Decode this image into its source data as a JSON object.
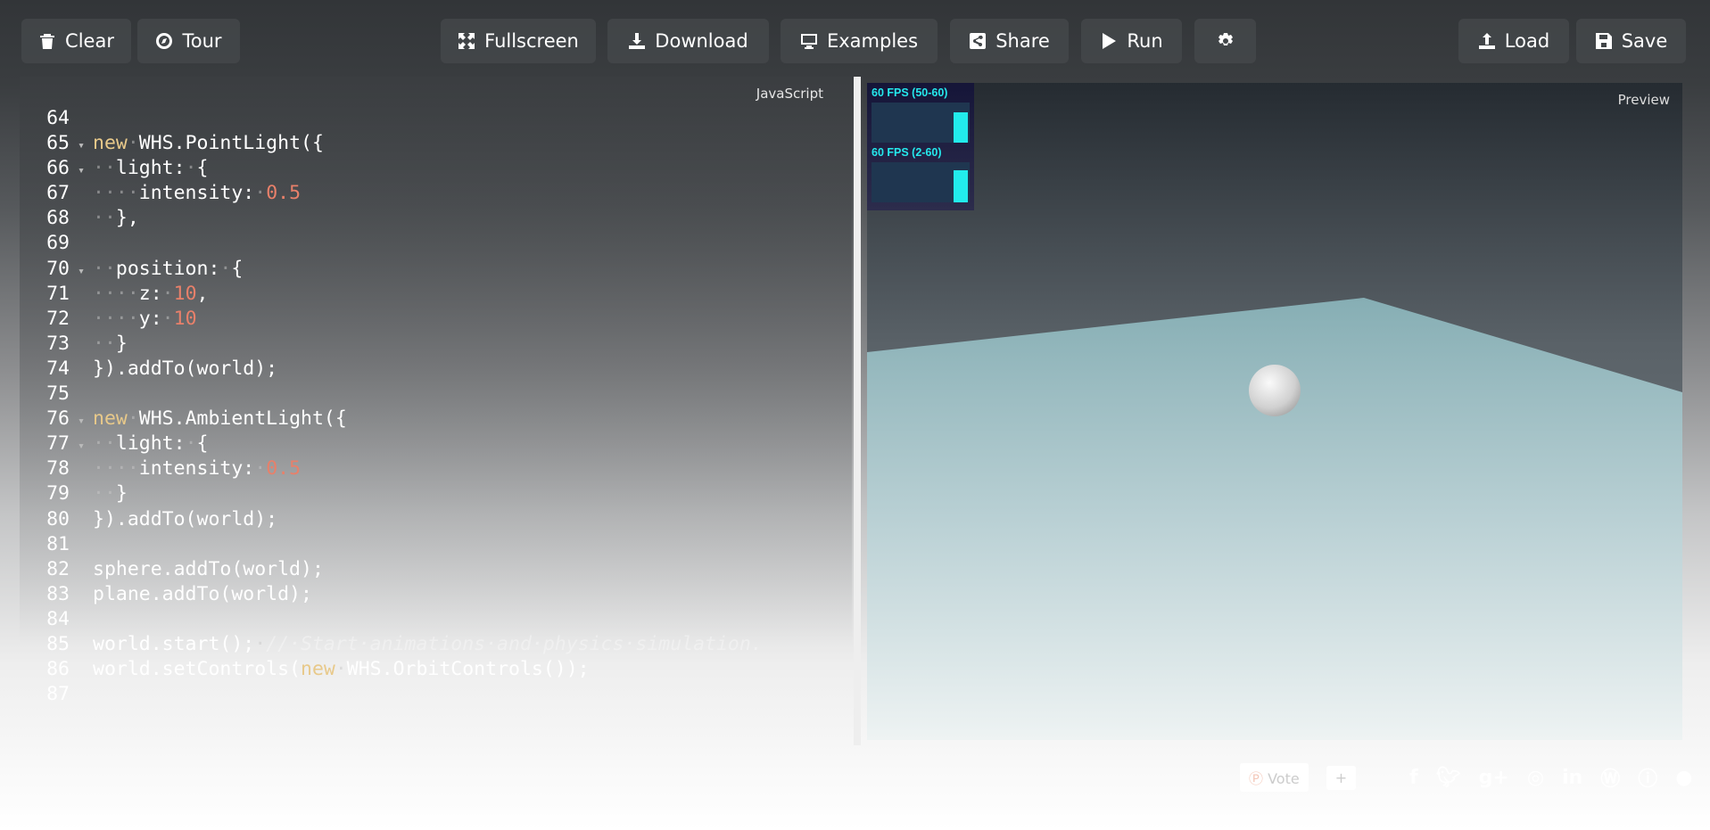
{
  "toolbar": {
    "clear": "Clear",
    "tour": "Tour",
    "fullscreen": "Fullscreen",
    "download": "Download",
    "examples": "Examples",
    "share": "Share",
    "run": "Run",
    "load": "Load",
    "save": "Save"
  },
  "editor": {
    "language": "JavaScript",
    "lines": [
      {
        "n": "64",
        "fold": false,
        "seg": []
      },
      {
        "n": "65",
        "fold": true,
        "seg": [
          [
            "new",
            "kw"
          ],
          [
            "·",
            "ws"
          ],
          [
            "WHS.PointLight({",
            "pl"
          ]
        ]
      },
      {
        "n": "66",
        "fold": true,
        "seg": [
          [
            "··",
            "ws"
          ],
          [
            "light:",
            "pl"
          ],
          [
            "·",
            "ws"
          ],
          [
            "{",
            "pl"
          ]
        ]
      },
      {
        "n": "67",
        "fold": false,
        "seg": [
          [
            "····",
            "ws"
          ],
          [
            "intensity:",
            "pl"
          ],
          [
            "·",
            "ws"
          ],
          [
            "0.5",
            "num"
          ]
        ]
      },
      {
        "n": "68",
        "fold": false,
        "seg": [
          [
            "··",
            "ws"
          ],
          [
            "},",
            "pl"
          ]
        ]
      },
      {
        "n": "69",
        "fold": false,
        "seg": []
      },
      {
        "n": "70",
        "fold": true,
        "seg": [
          [
            "··",
            "ws"
          ],
          [
            "position:",
            "pl"
          ],
          [
            "·",
            "ws"
          ],
          [
            "{",
            "pl"
          ]
        ]
      },
      {
        "n": "71",
        "fold": false,
        "seg": [
          [
            "····",
            "ws"
          ],
          [
            "z:",
            "pl"
          ],
          [
            "·",
            "ws"
          ],
          [
            "10",
            "num"
          ],
          [
            ",",
            "pl"
          ]
        ]
      },
      {
        "n": "72",
        "fold": false,
        "seg": [
          [
            "····",
            "ws"
          ],
          [
            "y:",
            "pl"
          ],
          [
            "·",
            "ws"
          ],
          [
            "10",
            "num"
          ]
        ]
      },
      {
        "n": "73",
        "fold": false,
        "seg": [
          [
            "··",
            "ws"
          ],
          [
            "}",
            "pl"
          ]
        ]
      },
      {
        "n": "74",
        "fold": false,
        "seg": [
          [
            "}).addTo(world);",
            "pl"
          ]
        ]
      },
      {
        "n": "75",
        "fold": false,
        "seg": []
      },
      {
        "n": "76",
        "fold": true,
        "seg": [
          [
            "new",
            "kw"
          ],
          [
            "·",
            "ws"
          ],
          [
            "WHS.AmbientLight({",
            "pl"
          ]
        ]
      },
      {
        "n": "77",
        "fold": true,
        "seg": [
          [
            "··",
            "ws"
          ],
          [
            "light:",
            "pl"
          ],
          [
            "·",
            "ws"
          ],
          [
            "{",
            "pl"
          ]
        ]
      },
      {
        "n": "78",
        "fold": false,
        "seg": [
          [
            "····",
            "ws"
          ],
          [
            "intensity:",
            "pl"
          ],
          [
            "·",
            "ws"
          ],
          [
            "0.5",
            "num"
          ]
        ]
      },
      {
        "n": "79",
        "fold": false,
        "seg": [
          [
            "··",
            "ws"
          ],
          [
            "}",
            "pl"
          ]
        ]
      },
      {
        "n": "80",
        "fold": false,
        "seg": [
          [
            "}).addTo(world);",
            "pl"
          ]
        ]
      },
      {
        "n": "81",
        "fold": false,
        "seg": []
      },
      {
        "n": "82",
        "fold": false,
        "seg": [
          [
            "sphere.addTo(world);",
            "pl"
          ]
        ]
      },
      {
        "n": "83",
        "fold": false,
        "seg": [
          [
            "plane.addTo(world);",
            "pl"
          ]
        ]
      },
      {
        "n": "84",
        "fold": false,
        "seg": []
      },
      {
        "n": "85",
        "fold": false,
        "seg": [
          [
            "world.start();",
            "pl"
          ],
          [
            "·",
            "ws"
          ],
          [
            "//·Start·animations·and·physics·simulation.",
            "cm"
          ]
        ]
      },
      {
        "n": "86",
        "fold": false,
        "seg": [
          [
            "world.setControls(",
            "pl"
          ],
          [
            "new",
            "kw"
          ],
          [
            "·",
            "ws"
          ],
          [
            "WHS.OrbitControls());",
            "pl"
          ]
        ]
      },
      {
        "n": "87",
        "fold": false,
        "seg": []
      }
    ]
  },
  "preview": {
    "label": "Preview",
    "fps1": "60 FPS (50-60)",
    "fps2": "60 FPS (2-60)",
    "fps1_level": 0.75,
    "fps2_level": 0.8
  },
  "footer": {
    "vote": "Vote",
    "plus": "+"
  }
}
